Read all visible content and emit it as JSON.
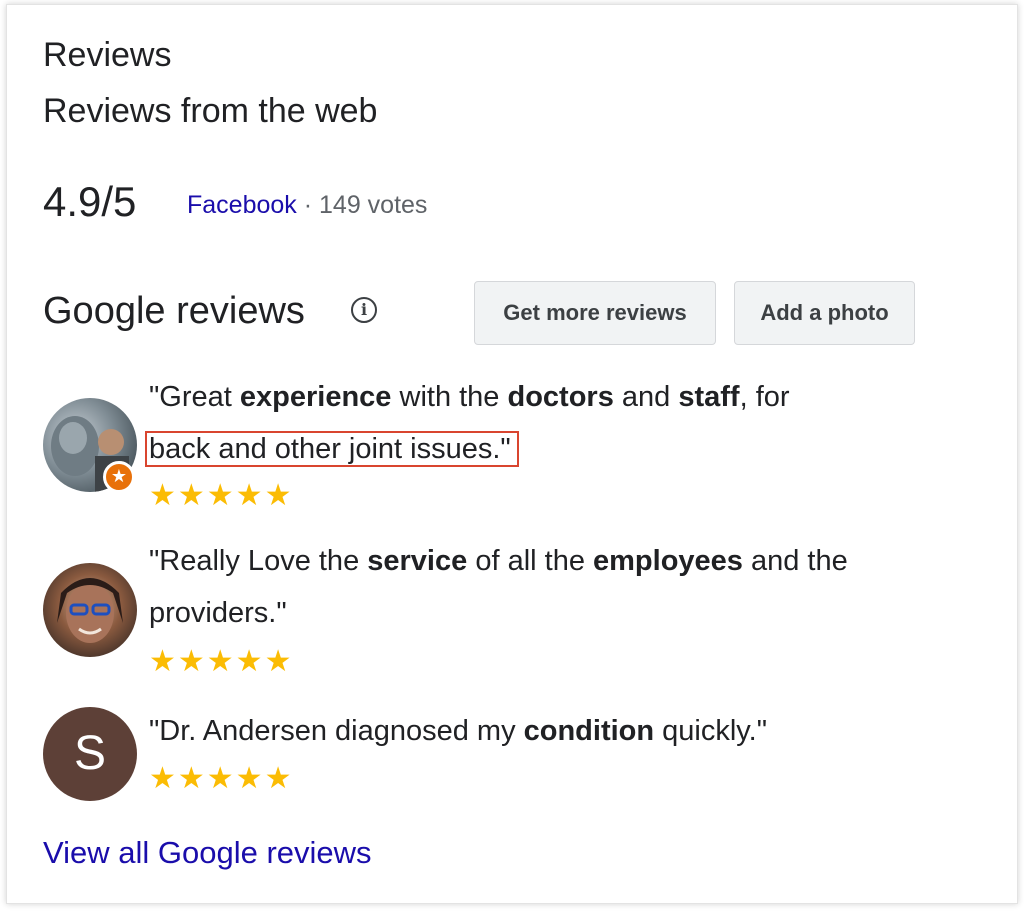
{
  "header": {
    "title": "Reviews",
    "subtitle": "Reviews from the web"
  },
  "web_rating": {
    "score": "4.9/5",
    "source": "Facebook",
    "separator": " · ",
    "votes": "149 votes"
  },
  "google_reviews": {
    "title": "Google reviews",
    "info_icon": "i",
    "buttons": {
      "get_more": "Get more reviews",
      "add_photo": "Add a photo"
    },
    "reviews": [
      {
        "avatar": "photo",
        "badge_icon": "local-guide-star-icon",
        "stars": "★★★★★",
        "rating": 5,
        "text_parts": [
          {
            "t": "\"Great ",
            "b": false
          },
          {
            "t": "experience",
            "b": true
          },
          {
            "t": " with the ",
            "b": false
          },
          {
            "t": "doctors",
            "b": true
          },
          {
            "t": " and ",
            "b": false
          },
          {
            "t": "staff",
            "b": true
          },
          {
            "t": ", for",
            "b": false
          }
        ],
        "highlighted_text": "back and other joint issues.\""
      },
      {
        "avatar": "photo",
        "stars": "★★★★★",
        "rating": 5,
        "text_parts": [
          {
            "t": "\"Really Love the ",
            "b": false
          },
          {
            "t": "service",
            "b": true
          },
          {
            "t": " of all the ",
            "b": false
          },
          {
            "t": "employees",
            "b": true
          },
          {
            "t": " and the providers.\"",
            "b": false
          }
        ]
      },
      {
        "avatar_letter": "S",
        "avatar_color": "#5d4037",
        "stars": "★★★★★",
        "rating": 5,
        "text_parts": [
          {
            "t": "\"Dr. Andersen diagnosed my ",
            "b": false
          },
          {
            "t": "condition",
            "b": true
          },
          {
            "t": " quickly.\"",
            "b": false
          }
        ]
      }
    ],
    "view_all": "View all Google reviews"
  },
  "colors": {
    "link": "#1a0dab",
    "star": "#fbbc04",
    "highlight_border": "#d9452f",
    "badge": "#e8710a"
  }
}
